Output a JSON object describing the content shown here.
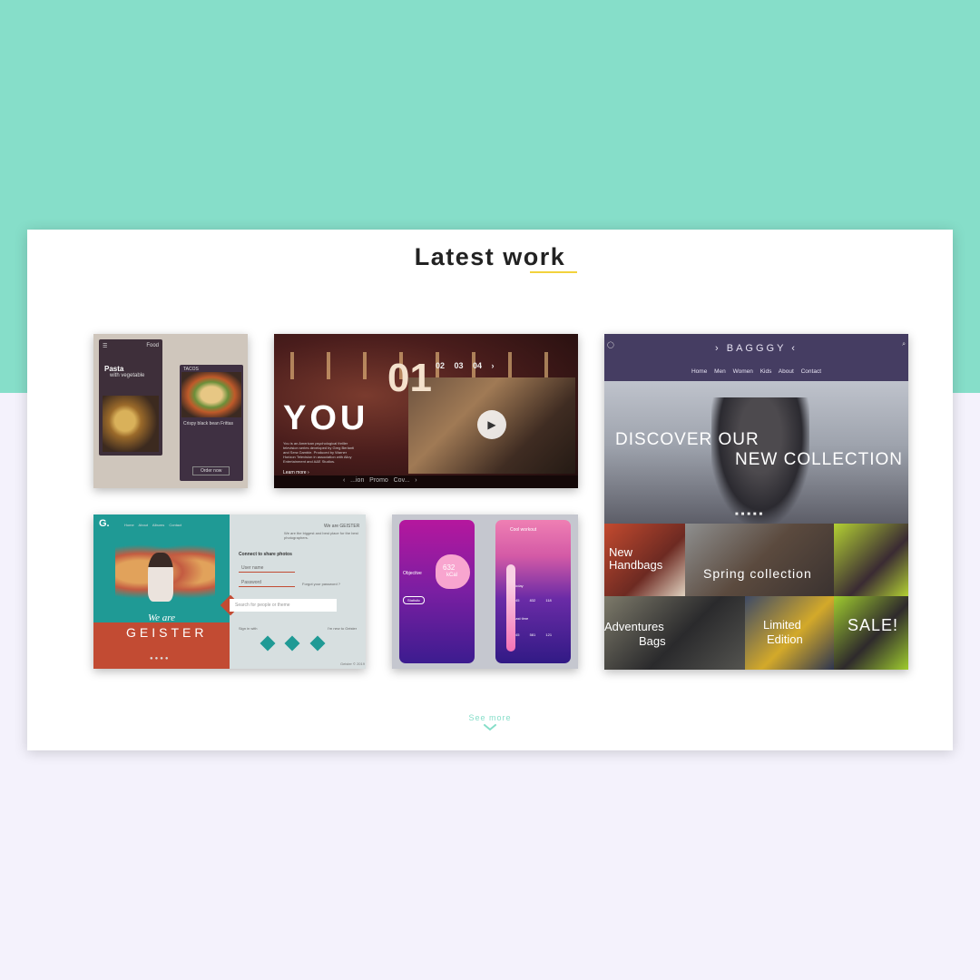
{
  "section": {
    "title": "Latest work",
    "see_more": "See more",
    "accent_color": "#f2d23c",
    "theme_color": "#86dec9"
  },
  "cards": {
    "food": {
      "phone1_title": "Pasta",
      "phone1_subtitle": "with vegetable",
      "phone1_header": "Food",
      "phone2_title": "TACOS",
      "phone2_item": "Crispy black bean Frittas",
      "phone2_button": "Order now"
    },
    "theater": {
      "big_number": "01",
      "numbers": "02 03 04 ›",
      "headline": "YOU",
      "description": "You is an American psychological thriller television series developed by Greg Berlanti and Sera Gamble. Produced by Warner Horizon Television in association with Alloy Entertainment and A&E Studios.",
      "learn_more": "Learn more ›",
      "bottom_nav": "‹   ...ion   Promo   Cov...   ›"
    },
    "baggy": {
      "logo": "› BAGGGY ‹",
      "nav": [
        "Home",
        "Men",
        "Women",
        "Kids",
        "About",
        "Contact"
      ],
      "hero_line1": "DISCOVER OUR",
      "hero_line2": "NEW COLLECTION",
      "tiles": {
        "new_handbags_1": "New",
        "new_handbags_2": "Handbags",
        "spring": "Spring collection",
        "adventures_1": "Adventures",
        "adventures_2": "Bags",
        "limited_1": "Limited",
        "limited_2": "Edition",
        "sale": "SALE!"
      }
    },
    "geister": {
      "logo": "G.",
      "nav": "Home  About  Albums  Contact",
      "we_are": "We are",
      "brand": "GEISTER",
      "header_right": "We are GEISTER",
      "tagline": "We are the biggest and best place for the best photographers.",
      "connect": "Connect to share photos",
      "user_placeholder": "User name",
      "password_placeholder": "Password",
      "forgot": "Forgot your password ?",
      "search_placeholder": "Search for people or theme",
      "sign_in_with": "Sign in with",
      "no_account": "I'm new to Geister",
      "footer": "Geister © 2019"
    },
    "fitness": {
      "phone1_label": "Objective",
      "phone1_value": "632",
      "phone1_unit": "kCal",
      "phone1_button": "Statistic",
      "phone2_header": "Cool workout",
      "today": "Today",
      "last_time": "Last time",
      "stats1": [
        "45",
        "832",
        "118"
      ],
      "stats2": [
        "45",
        "581",
        "121"
      ]
    }
  }
}
